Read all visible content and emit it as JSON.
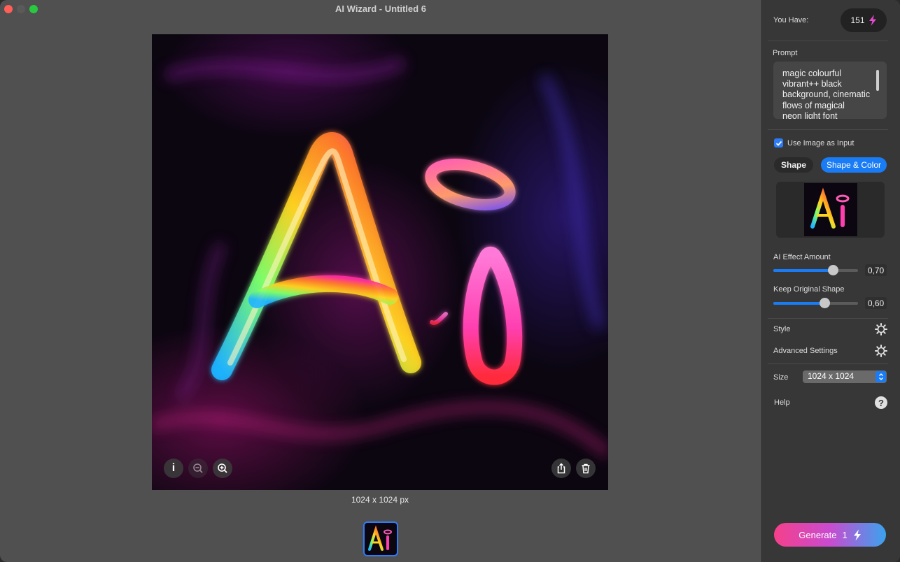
{
  "window": {
    "title": "AI Wizard - Untitled 6"
  },
  "canvas": {
    "dimensions_label": "1024 x 1024 px",
    "image_text": "Ai"
  },
  "toolbar": {
    "info_label": "i"
  },
  "sidebar": {
    "you_have_label": "You Have:",
    "credits": "151",
    "prompt_label": "Prompt",
    "prompt_text": "magic colourful vibrant++ black background, cinematic flows of magical\nneon light font",
    "use_image_label": "Use Image as Input",
    "use_image_checked": true,
    "mode_options": [
      "Shape",
      "Shape & Color"
    ],
    "mode_selected": "Shape & Color",
    "ai_effect_label": "AI Effect Amount",
    "ai_effect_value": "0,70",
    "ai_effect_fraction": 0.7,
    "keep_shape_label": "Keep Original Shape",
    "keep_shape_value": "0,60",
    "keep_shape_fraction": 0.6,
    "style_label": "Style",
    "advanced_label": "Advanced Settings",
    "size_label": "Size",
    "size_value": "1024 x 1024",
    "help_label": "Help",
    "generate_label": "Generate",
    "generate_cost": "1"
  },
  "colors": {
    "accent": "#1a7cf5",
    "window_bg": "#505050",
    "sidebar_bg": "#373737"
  }
}
